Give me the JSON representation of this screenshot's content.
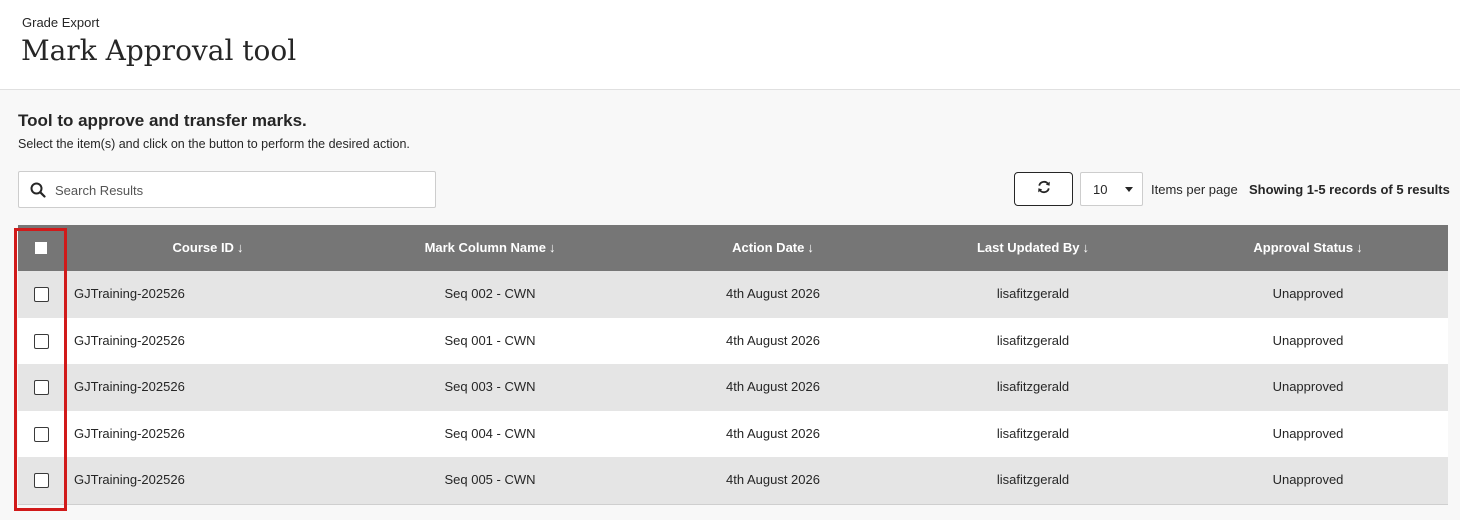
{
  "header": {
    "eyebrow": "Grade Export",
    "title": "Mark Approval tool"
  },
  "intro": {
    "heading": "Tool to approve and transfer marks.",
    "subtext": "Select the item(s) and click on the button to perform the desired action."
  },
  "search": {
    "placeholder": "Search Results",
    "value": ""
  },
  "pagination": {
    "per_page_value": "10",
    "items_per_page_label": "Items per page",
    "showing_text": "Showing 1-5 records of 5 results"
  },
  "table": {
    "columns": [
      "Course ID",
      "Mark Column Name",
      "Action Date",
      "Last Updated By",
      "Approval Status"
    ],
    "sort_arrow": "↓",
    "rows": [
      [
        "GJTraining-202526",
        "Seq 002 - CWN",
        "4th August 2026",
        "lisafitzgerald",
        "Unapproved"
      ],
      [
        "GJTraining-202526",
        "Seq 001 - CWN",
        "4th August 2026",
        "lisafitzgerald",
        "Unapproved"
      ],
      [
        "GJTraining-202526",
        "Seq 003 - CWN",
        "4th August 2026",
        "lisafitzgerald",
        "Unapproved"
      ],
      [
        "GJTraining-202526",
        "Seq 004 - CWN",
        "4th August 2026",
        "lisafitzgerald",
        "Unapproved"
      ],
      [
        "GJTraining-202526",
        "Seq 005 - CWN",
        "4th August 2026",
        "lisafitzgerald",
        "Unapproved"
      ]
    ]
  },
  "icons": {
    "search": "search-icon",
    "refresh": "refresh-icon",
    "dropdown": "chevron-down-icon"
  },
  "colors": {
    "header_bg": "#767676",
    "row_alt_bg": "#e5e5e5",
    "highlight": "#d11a1a"
  }
}
